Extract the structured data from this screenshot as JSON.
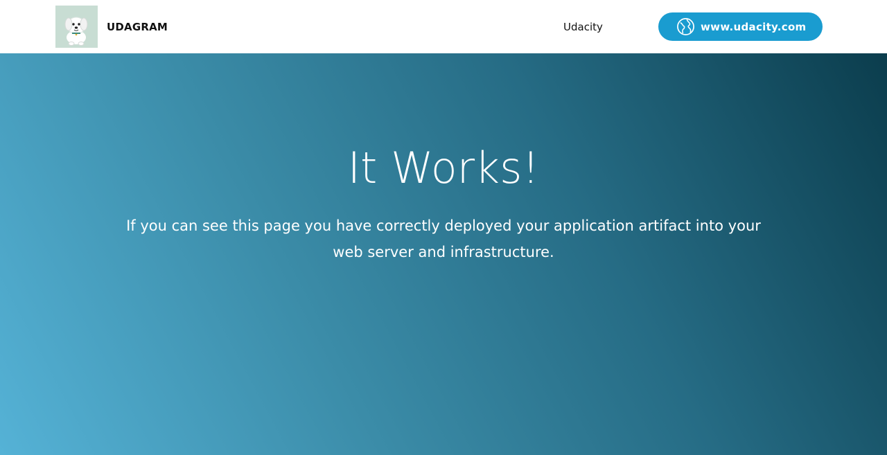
{
  "header": {
    "brand": "UDAGRAM",
    "nav_link": "Udacity",
    "cta_label": "www.udacity.com",
    "cta_icon": "globe-icon",
    "logo_icon": "dog-icon"
  },
  "hero": {
    "title": "It Works!",
    "text": "If you can see this page you have correctly deployed your application artifact into your web server and infrastructure."
  },
  "colors": {
    "cta_background": "#1a9cd0",
    "hero_gradient_start": "#55b2d6",
    "hero_gradient_end": "#0b3d4d"
  }
}
